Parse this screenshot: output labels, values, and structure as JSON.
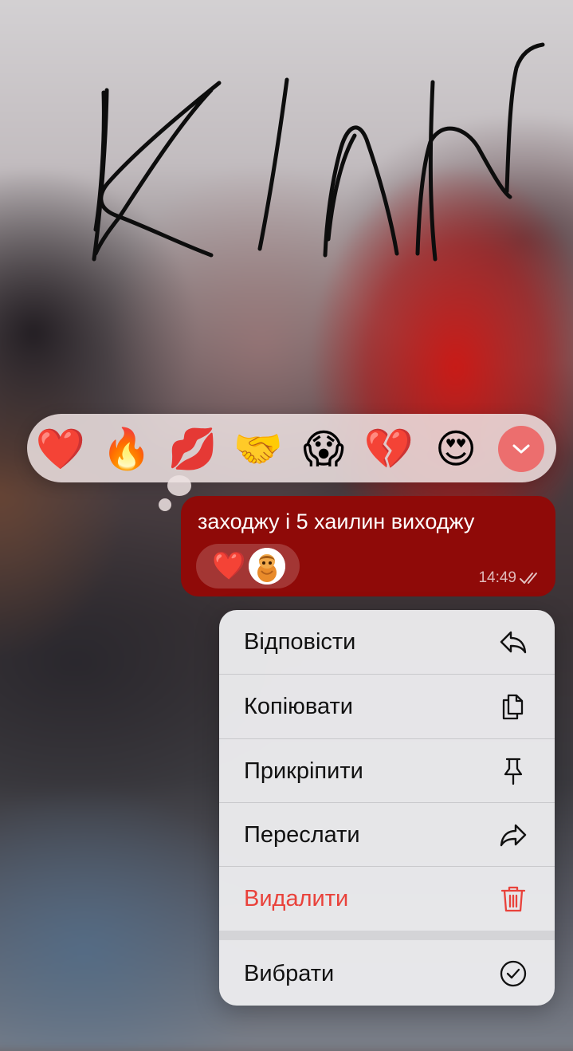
{
  "background": {
    "handwriting_text": "KINN"
  },
  "reactions_bar": {
    "emojis": [
      "❤️",
      "🔥",
      "💋",
      "🤝",
      "😱",
      "💔",
      "😍"
    ],
    "icon_names": [
      "red-heart",
      "fire",
      "kiss-mark",
      "handshake",
      "screaming-face",
      "broken-heart",
      "heart-eyes"
    ],
    "expand_icon": "chevron-down-icon",
    "expand_color": "#ec6e6e"
  },
  "message": {
    "text": "заходжу і 5 хаилин виходжу",
    "reaction_emoji": "❤️",
    "time": "14:49",
    "status_icon": "double-check-icon",
    "bubble_color": "#8f0a08"
  },
  "context_menu": {
    "items": [
      {
        "label": "Відповісти",
        "icon": "reply-icon"
      },
      {
        "label": "Копіювати",
        "icon": "copy-icon"
      },
      {
        "label": "Прикріпити",
        "icon": "pin-icon"
      },
      {
        "label": "Переслати",
        "icon": "forward-icon"
      },
      {
        "label": "Видалити",
        "icon": "trash-icon",
        "destructive": true,
        "color": "#e9423b"
      },
      {
        "label": "Вибрати",
        "icon": "checkmark-circle-icon"
      }
    ]
  }
}
